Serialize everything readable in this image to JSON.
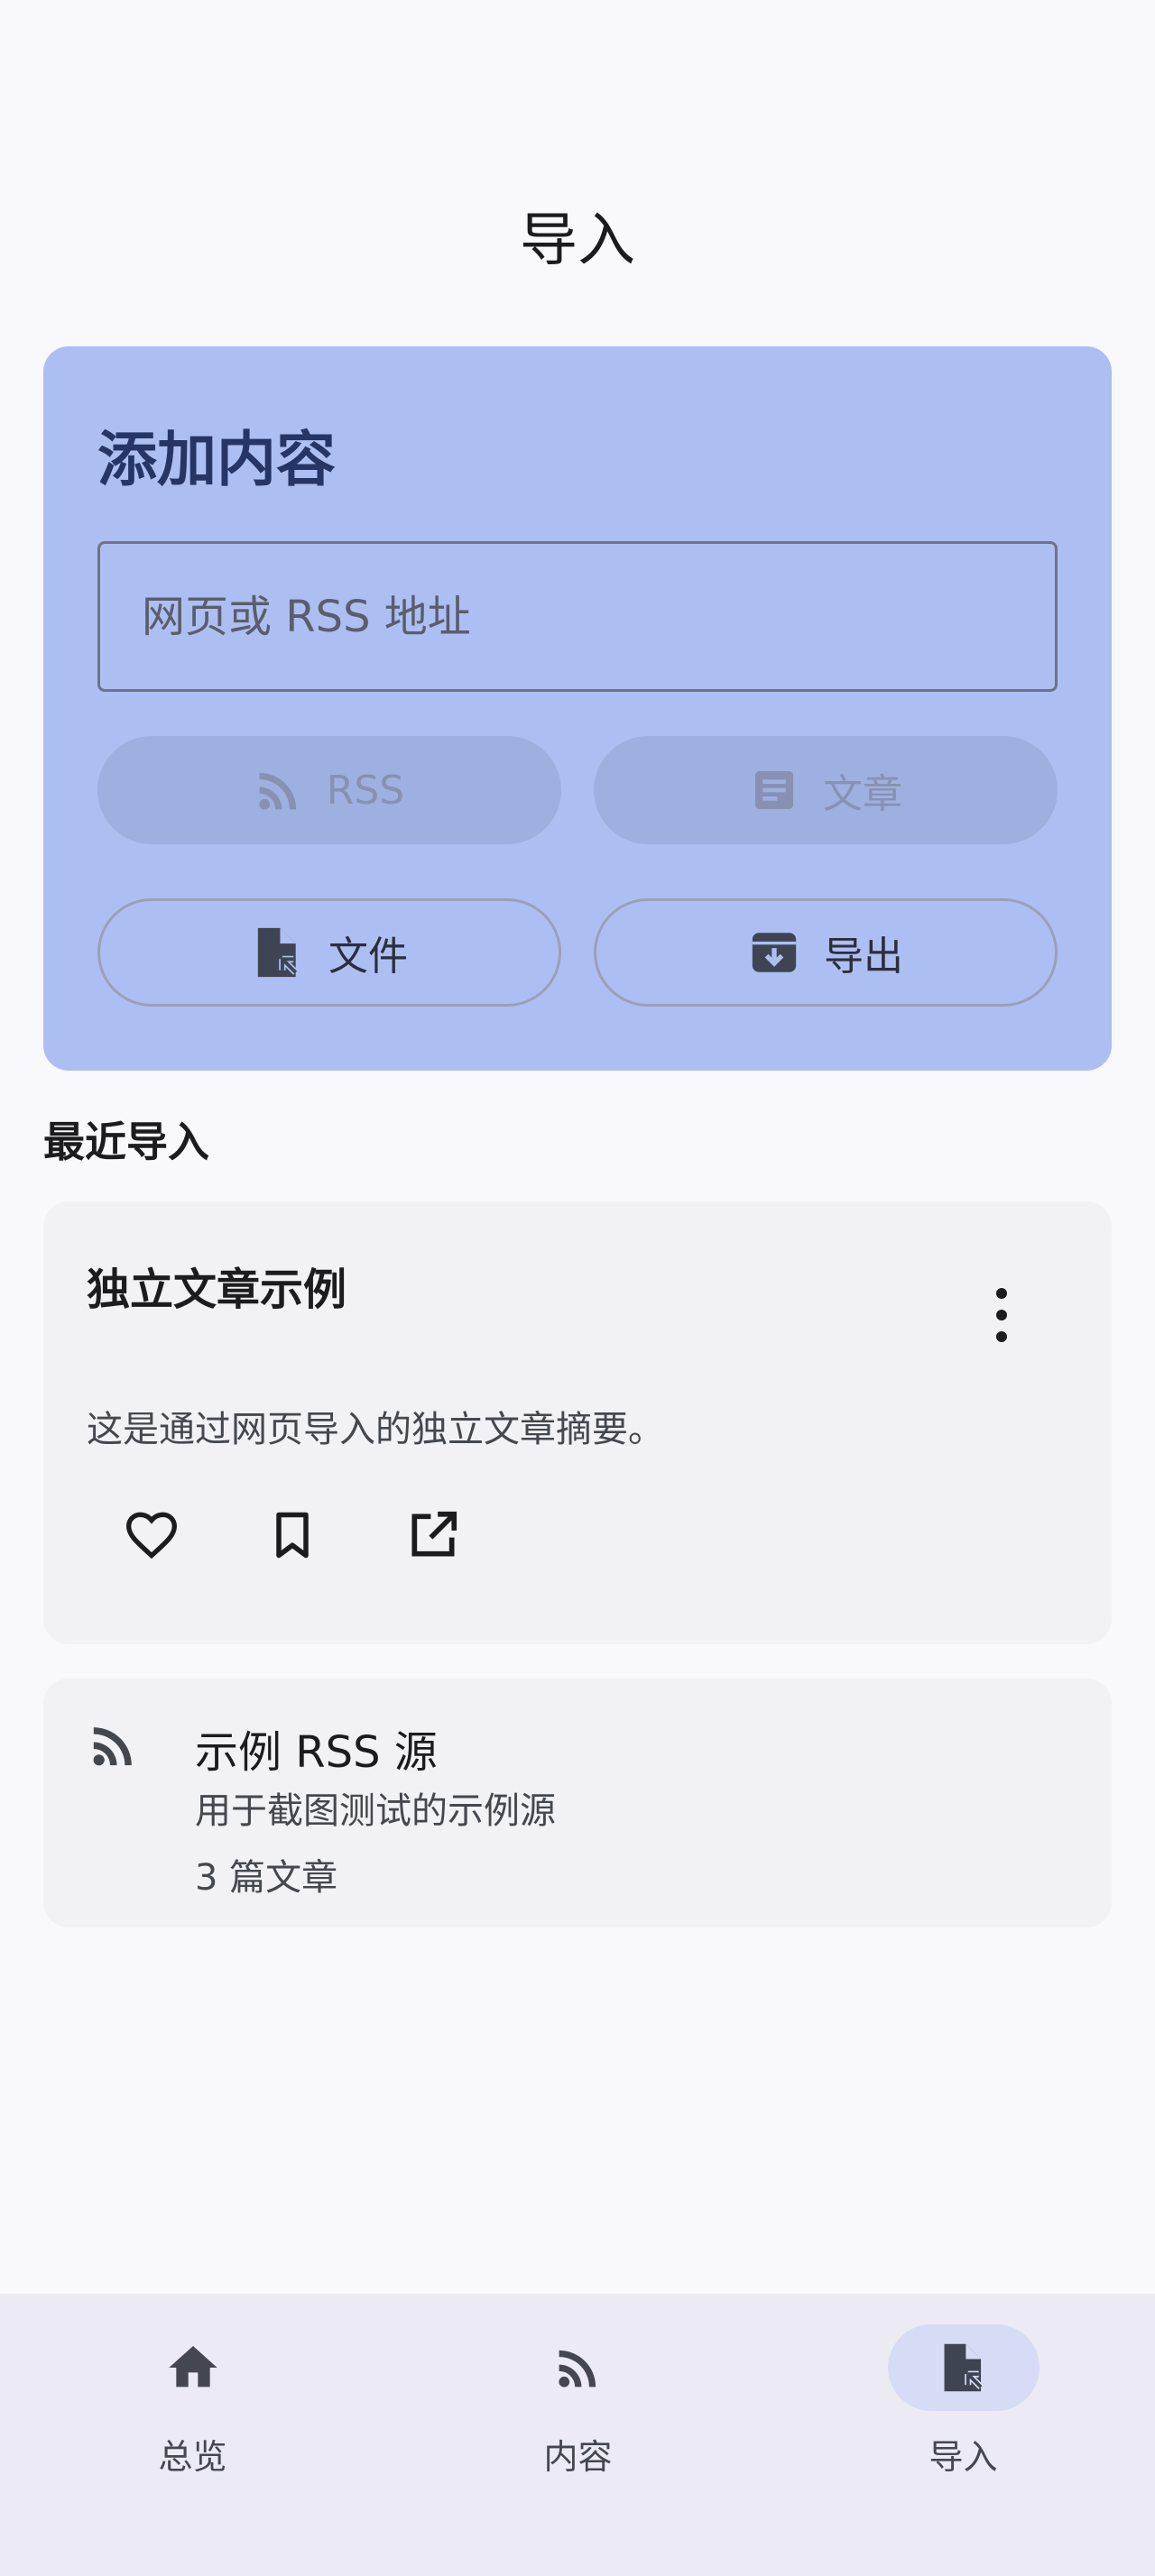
{
  "header": {
    "title": "导入"
  },
  "add_card": {
    "title": "添加内容",
    "url_placeholder": "网页或 RSS 地址",
    "rss_button": "RSS",
    "article_button": "文章",
    "file_button": "文件",
    "export_button": "导出"
  },
  "recent": {
    "heading": "最近导入",
    "article": {
      "title": "独立文章示例",
      "summary": "这是通过网页导入的独立文章摘要。"
    },
    "feed": {
      "name": "示例 RSS 源",
      "description": "用于截图测试的示例源",
      "count": "3 篇文章"
    }
  },
  "bottom_nav": {
    "items": [
      {
        "label": "总览",
        "icon": "home-icon"
      },
      {
        "label": "内容",
        "icon": "rss-icon"
      },
      {
        "label": "导入",
        "icon": "file-import-icon",
        "active": true
      }
    ]
  },
  "colors": {
    "card": "#adbff2",
    "accent": "#263566",
    "active_pill": "#d6dcf6"
  }
}
